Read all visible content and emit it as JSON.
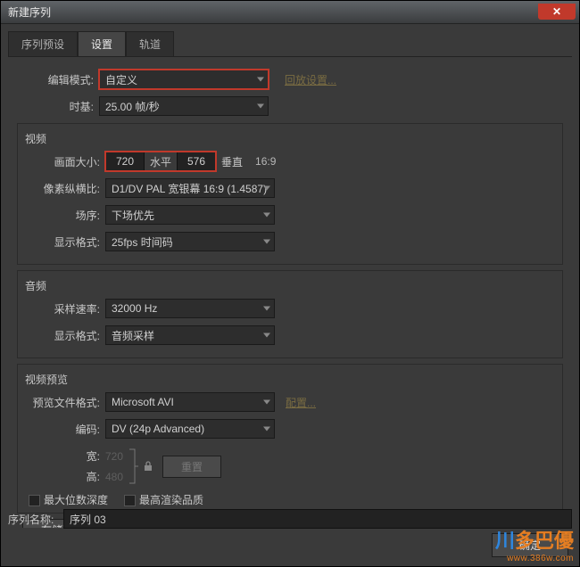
{
  "window": {
    "title": "新建序列",
    "close_glyph": "✕"
  },
  "tabs": {
    "preset": "序列预设",
    "settings": "设置",
    "tracks": "轨道"
  },
  "top": {
    "edit_mode_label": "编辑模式:",
    "edit_mode_value": "自定义",
    "go_settings": "回放设置...",
    "timebase_label": "时基:",
    "timebase_value": "25.00 帧/秒"
  },
  "video": {
    "title": "视频",
    "frame_size_label": "画面大小:",
    "width": "720",
    "horz_label": "水平",
    "height": "576",
    "vert_label": "垂直",
    "aspect": "16:9",
    "par_label": "像素纵横比:",
    "par_value": "D1/DV PAL 宽银幕 16:9 (1.4587)",
    "field_label": "场序:",
    "field_value": "下场优先",
    "disp_label": "显示格式:",
    "disp_value": "25fps 时间码"
  },
  "audio": {
    "title": "音频",
    "rate_label": "采样速率:",
    "rate_value": "32000 Hz",
    "disp_label": "显示格式:",
    "disp_value": "音频采样"
  },
  "preview": {
    "title": "视频预览",
    "file_fmt_label": "预览文件格式:",
    "file_fmt_value": "Microsoft AVI",
    "config": "配置...",
    "codec_label": "编码:",
    "codec_value": "DV (24p Advanced)",
    "width_label": "宽:",
    "width_value": "720",
    "height_label": "高:",
    "height_value": "480",
    "reset": "重置",
    "max_bit_depth": "最大位数深度",
    "max_render_q": "最高渲染品质"
  },
  "save_preset": "存储预设...",
  "seq": {
    "label": "序列名称:",
    "value": "序列 03"
  },
  "ok": "确定",
  "watermark": {
    "text": "多巴優",
    "url": "www.386w.com"
  }
}
